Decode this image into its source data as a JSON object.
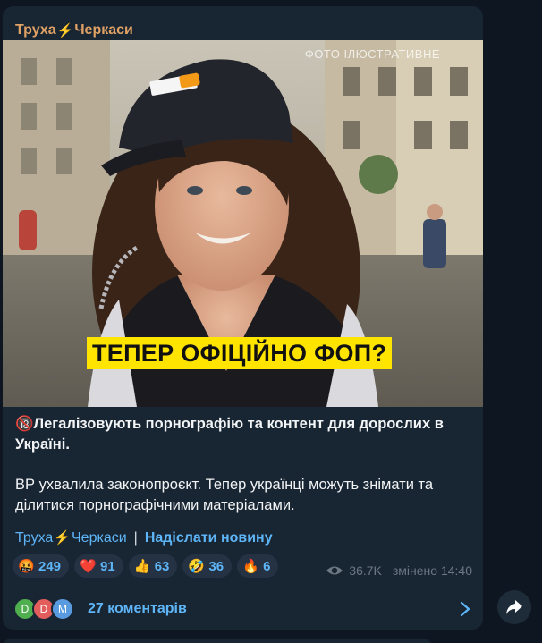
{
  "channel": {
    "name_left": "Труха",
    "name_right": "Черкаси",
    "bolt": "⚡"
  },
  "photo": {
    "watermark": "ФОТО ІЛЮСТРАТИВНЕ",
    "overlay_text": "ТЕПЕР ОФІЦІЙНО ФОП?"
  },
  "post": {
    "emoji": "🔞",
    "headline": "Легалізовують порнографію та контент для дорослих в Україні.",
    "body": "ВР ухвалила законопроєкт. Тепер українці можуть знімати та ділитися порнографічними матеріалами."
  },
  "links": {
    "channel_left": "Труха",
    "channel_right": "Черкаси",
    "separator": "|",
    "submit": "Надіслати новину"
  },
  "reactions": [
    {
      "emoji": "🤬",
      "count": "249",
      "icon": "angry-face-icon"
    },
    {
      "emoji": "❤️",
      "count": "91",
      "icon": "heart-icon"
    },
    {
      "emoji": "👍",
      "count": "63",
      "icon": "thumbs-up-icon"
    },
    {
      "emoji": "🤣",
      "count": "36",
      "icon": "rofl-icon"
    },
    {
      "emoji": "🔥",
      "count": "6",
      "icon": "fire-icon"
    }
  ],
  "meta": {
    "views": "36.7K",
    "edited": "змінено 14:40"
  },
  "comments": {
    "avatars": [
      {
        "letter": "D",
        "color": "#4fae4e"
      },
      {
        "letter": "D",
        "color": "#e35d5d"
      },
      {
        "letter": "M",
        "color": "#5a9be0"
      }
    ],
    "label": "27 коментарів"
  }
}
